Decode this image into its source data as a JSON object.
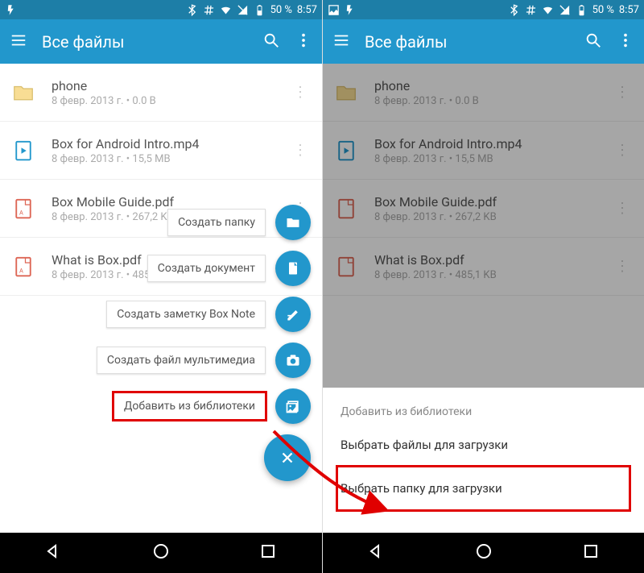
{
  "status": {
    "battery": "50 %",
    "time": "8:57"
  },
  "toolbar": {
    "title": "Все файлы"
  },
  "files": [
    {
      "name": "phone",
      "meta": "8 февр. 2013 г.  • 0.0 B",
      "type": "folder"
    },
    {
      "name": "Box for Android Intro.mp4",
      "meta": "8 февр. 2013 г.  • 15,5 MB",
      "type": "video"
    },
    {
      "name": "Box Mobile Guide.pdf",
      "meta": "8 февр. 2013 г.  • 267,2 KB",
      "type": "pdf"
    },
    {
      "name": "What is Box.pdf",
      "meta": "8 февр. 2013 г.  • 485,1 KB",
      "type": "pdf"
    }
  ],
  "fab": {
    "close": "×",
    "items": [
      {
        "label": "Создать папку",
        "icon": "folder"
      },
      {
        "label": "Создать документ",
        "icon": "doc"
      },
      {
        "label": "Создать заметку Box Note",
        "icon": "note"
      },
      {
        "label": "Создать файл мультимедиа",
        "icon": "camera"
      },
      {
        "label": "Добавить из библиотеки",
        "icon": "library"
      }
    ]
  },
  "sheet": {
    "heading": "Добавить из библиотеки",
    "options": [
      "Выбрать файлы для загрузки",
      "Выбрать папку для загрузки"
    ]
  }
}
